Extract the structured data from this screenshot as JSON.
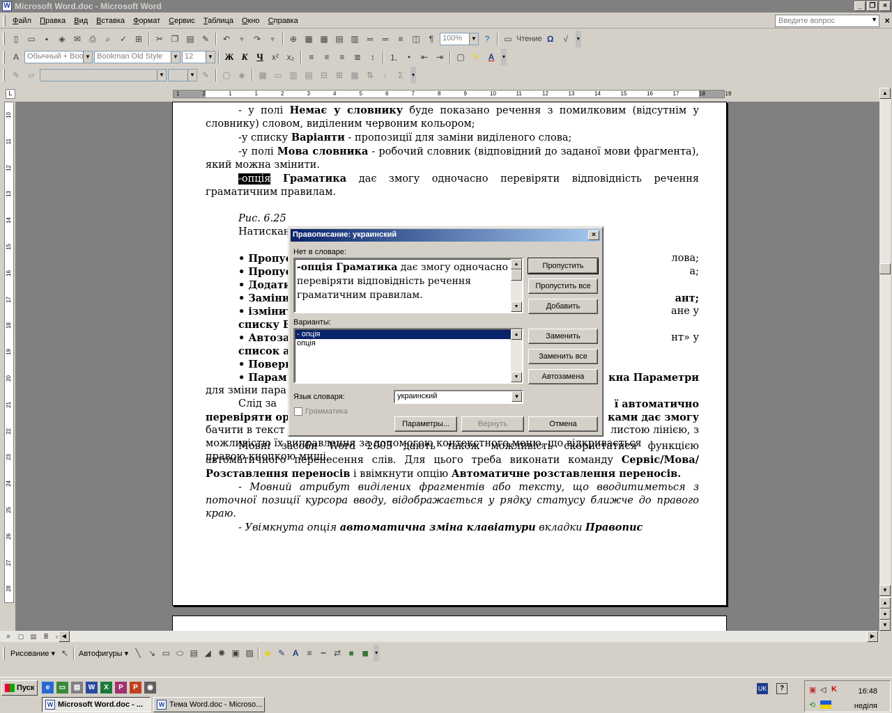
{
  "window": {
    "title": "Microsoft Word.doc - Microsoft Word",
    "app_icon": "W"
  },
  "menu": {
    "items": [
      "Файл",
      "Правка",
      "Вид",
      "Вставка",
      "Формат",
      "Сервис",
      "Таблица",
      "Окно",
      "Справка"
    ],
    "ask_placeholder": "Введите вопрос"
  },
  "toolbar_standard": {
    "zoom": "100%",
    "read_label": "Чтение"
  },
  "toolbar_format": {
    "style": "Обычный + Boo",
    "font": "Bookman Old Style",
    "size": "12",
    "bold": "Ж",
    "italic": "К",
    "underline": "Ч"
  },
  "ruler": {
    "h_ticks": [
      "1",
      "2",
      "1",
      "1",
      "2",
      "3",
      "4",
      "5",
      "6",
      "7",
      "8",
      "9",
      "10",
      "11",
      "12",
      "13",
      "14",
      "15",
      "16",
      "17",
      "18",
      "19"
    ],
    "v_ticks": [
      "10",
      "11",
      "12",
      "13",
      "14",
      "15",
      "16",
      "17",
      "18",
      "19",
      "20",
      "21",
      "22",
      "23",
      "24",
      "25",
      "26",
      "27",
      "28"
    ]
  },
  "document": {
    "p1_a": "- у полі ",
    "p1_b": "Немає у словнику",
    "p1_c": " буде показано речення з помилковим (відсутнім у словнику) словом, виділеним червоним кольором;",
    "p2_a": "-у списку ",
    "p2_b": "Варіанти",
    "p2_c": " - пропозиції для заміни виділеного слова;",
    "p3_a": "-у полі ",
    "p3_b": "Мова словника",
    "p3_c": " - робочий словник (відповідний до заданої мови фрагмента), який можна змінити.",
    "p4_a": "-опція",
    "p4_b": "Граматика",
    "p4_c": " дає змогу одночасно перевіряти відповідність речення граматичним правилам.",
    "fig": "Рис. 6.25",
    "p5": "Натискання кнопок діалогового вікна означає таке:",
    "left_frag": [
      "• Пропус",
      "• Пропус",
      "• Додати",
      "• Заміни",
      "• ізмінити",
      "списку В",
      "• Автоза",
      "список а",
      "• Поверн",
      "• Парам",
      "для зміни пара",
      "Слід за",
      "перевіряти ор",
      "бачити в текст",
      "можливістю їх виправлення за допомогою контекстного меню, що відкривається",
      "правою кнопкою миші."
    ],
    "right_frag": [
      "лова;",
      "а;",
      "",
      "ант;",
      "ане у",
      "",
      "нт» у",
      "",
      "",
      "кна Параметри",
      "",
      "ї автоматично",
      "ками дає змогу",
      "листою лінією, з"
    ],
    "p6_a": "Мовні засоби Word 2003 дають також можливість скористатися функцією автоматичного перенесення слів. Для цього треба виконати команду ",
    "p6_b": "Сервіс/Мова/Розставлення переносів",
    "p6_c": " і ввімкнути опцію ",
    "p6_d": "Автоматичне розставлення переносів.",
    "p7": "- Мовний атрибут виділених фрагментів або тексту, що вводитиметься з поточної позиції курсора вводу, відображається у рядку статусу ближче до правого краю.",
    "p8_a": "- Увімкнута опція ",
    "p8_b": "автоматична зміна клавіатури",
    "p8_c": " вкладки ",
    "p8_d": "Правопис"
  },
  "dialog": {
    "title": "Правописание: украинский",
    "not_in_dict_label": "Нет в словаре:",
    "sentence_bold": "-опція Граматика",
    "sentence_rest": " дає змогу одночасно перевіряти відповідність речення граматичним правилам.",
    "suggestions_label": "Варианты:",
    "suggestions": [
      "- опція",
      "опція"
    ],
    "lang_label": "Язык словаря:",
    "lang_value": "украинский",
    "grammar_label": "Грамматика",
    "btn_ignore": "Пропустить",
    "btn_ignore_all": "Пропустить все",
    "btn_add": "Добавить",
    "btn_change": "Заменить",
    "btn_change_all": "Заменить все",
    "btn_autocorrect": "Автозамена",
    "btn_options": "Параметры...",
    "btn_undo": "Вернуть",
    "btn_cancel": "Отмена"
  },
  "drawing": {
    "draw_label": "Рисование",
    "autoshapes_label": "Автофигуры"
  },
  "taskbar": {
    "start": "Пуск",
    "tasks": [
      "Microsoft Word.doc - ...",
      "Тема Word.doc - Microso..."
    ],
    "lang": "UK",
    "time": "16:48",
    "day": "неділя"
  }
}
